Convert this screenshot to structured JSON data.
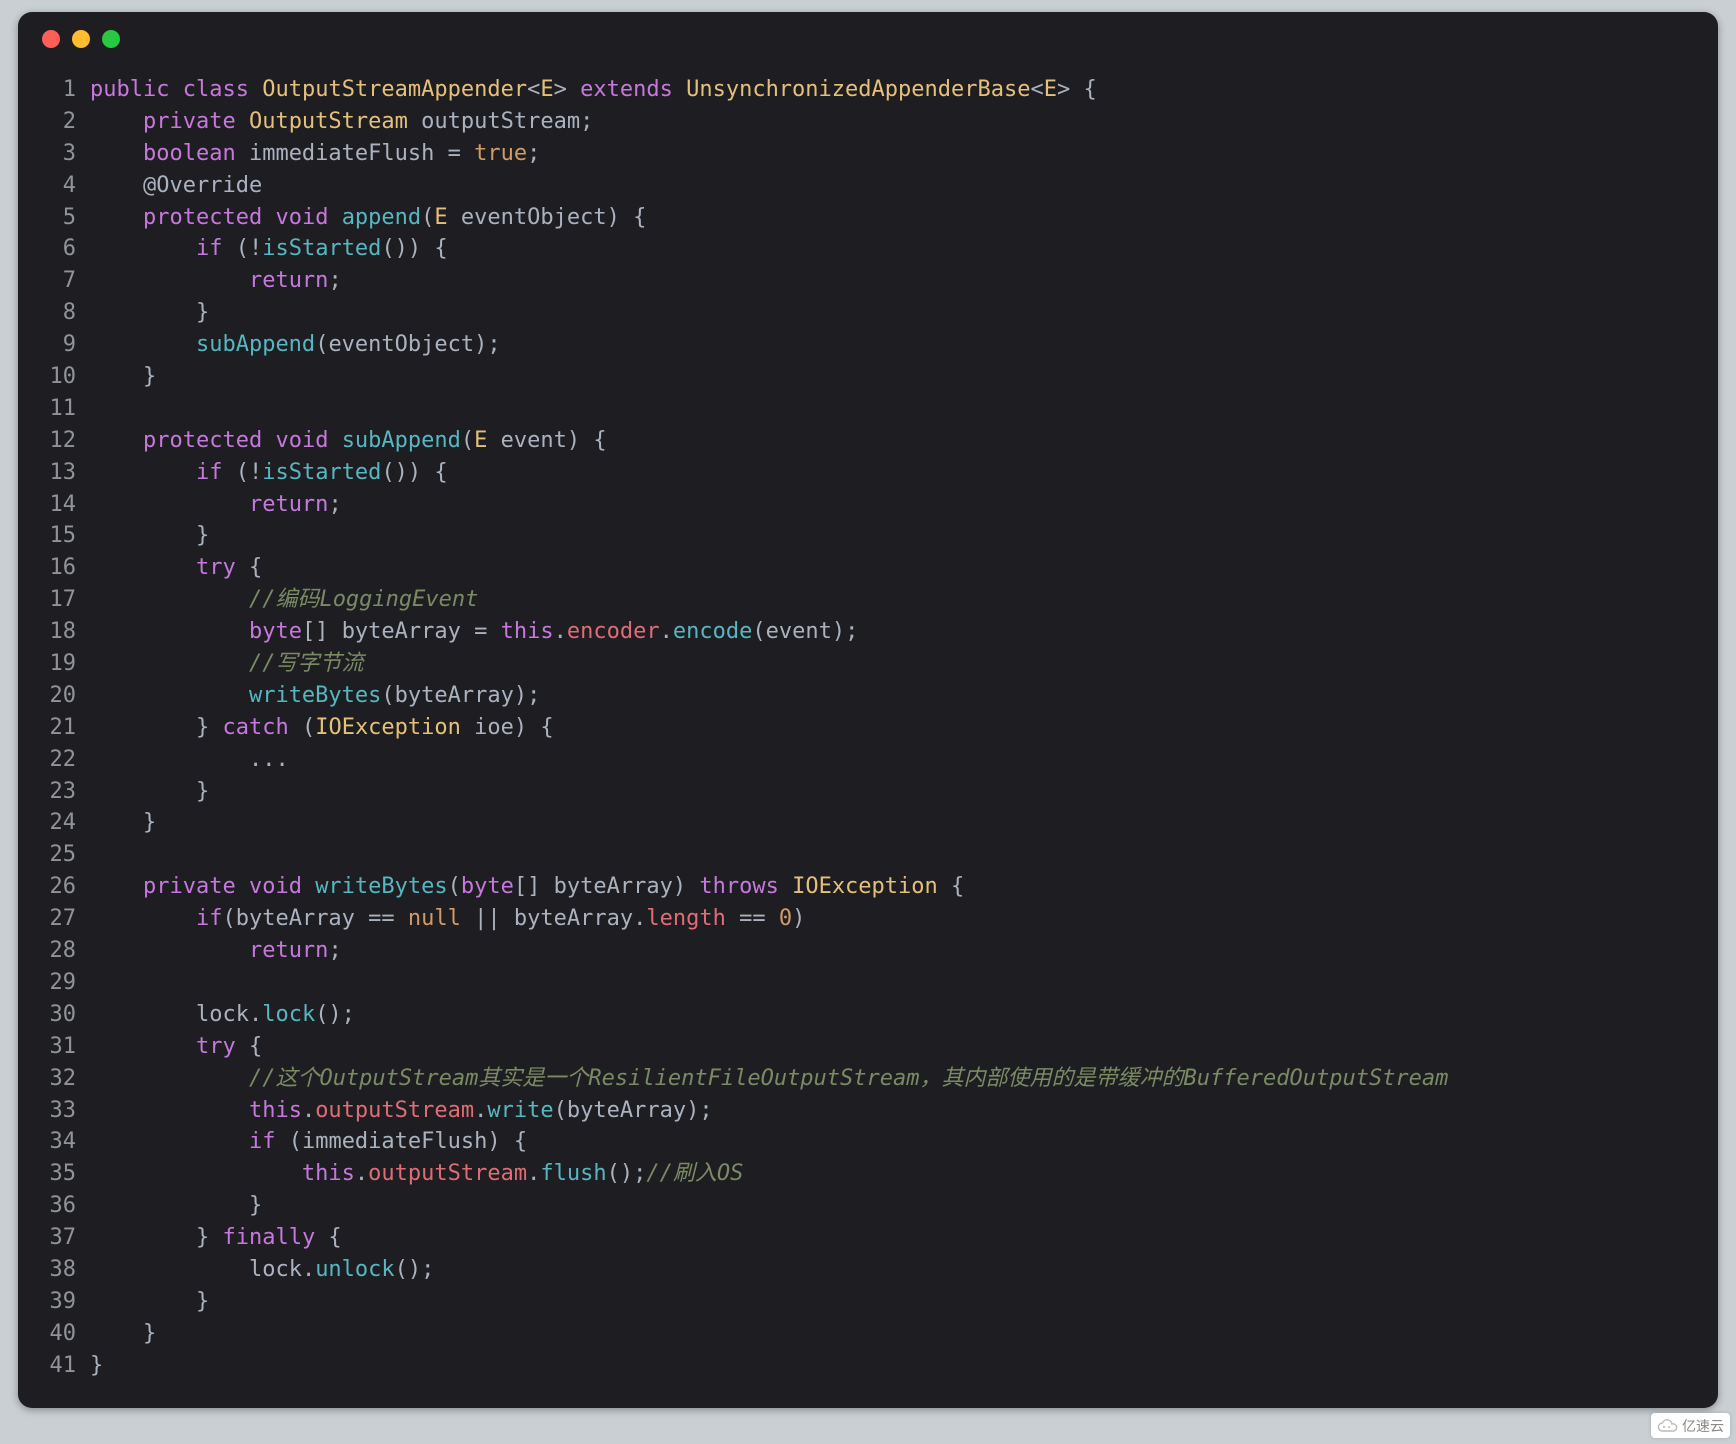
{
  "watermark": "亿速云",
  "lines": [
    {
      "n": 1,
      "tokens": [
        {
          "c": "kw",
          "t": "public"
        },
        {
          "c": "punc",
          "t": " "
        },
        {
          "c": "kw",
          "t": "class"
        },
        {
          "c": "punc",
          "t": " "
        },
        {
          "c": "type",
          "t": "OutputStreamAppender"
        },
        {
          "c": "punc",
          "t": "<"
        },
        {
          "c": "type",
          "t": "E"
        },
        {
          "c": "punc",
          "t": "> "
        },
        {
          "c": "kw",
          "t": "extends"
        },
        {
          "c": "punc",
          "t": " "
        },
        {
          "c": "type",
          "t": "UnsynchronizedAppenderBase"
        },
        {
          "c": "punc",
          "t": "<"
        },
        {
          "c": "type",
          "t": "E"
        },
        {
          "c": "punc",
          "t": "> {"
        }
      ]
    },
    {
      "n": 2,
      "indent": 4,
      "tokens": [
        {
          "c": "kw",
          "t": "private"
        },
        {
          "c": "punc",
          "t": " "
        },
        {
          "c": "type",
          "t": "OutputStream"
        },
        {
          "c": "punc",
          "t": " "
        },
        {
          "c": "var",
          "t": "outputStream"
        },
        {
          "c": "punc",
          "t": ";"
        }
      ]
    },
    {
      "n": 3,
      "indent": 4,
      "tokens": [
        {
          "c": "kw",
          "t": "boolean"
        },
        {
          "c": "punc",
          "t": " "
        },
        {
          "c": "var",
          "t": "immediateFlush"
        },
        {
          "c": "punc",
          "t": " = "
        },
        {
          "c": "lit",
          "t": "true"
        },
        {
          "c": "punc",
          "t": ";"
        }
      ]
    },
    {
      "n": 4,
      "indent": 4,
      "tokens": [
        {
          "c": "ann",
          "t": "@Override"
        }
      ]
    },
    {
      "n": 5,
      "indent": 4,
      "tokens": [
        {
          "c": "kw",
          "t": "protected"
        },
        {
          "c": "punc",
          "t": " "
        },
        {
          "c": "kw",
          "t": "void"
        },
        {
          "c": "punc",
          "t": " "
        },
        {
          "c": "fn",
          "t": "append"
        },
        {
          "c": "punc",
          "t": "("
        },
        {
          "c": "type",
          "t": "E"
        },
        {
          "c": "punc",
          "t": " "
        },
        {
          "c": "var",
          "t": "eventObject"
        },
        {
          "c": "punc",
          "t": ") {"
        }
      ]
    },
    {
      "n": 6,
      "indent": 8,
      "tokens": [
        {
          "c": "kw",
          "t": "if"
        },
        {
          "c": "punc",
          "t": " (!"
        },
        {
          "c": "fn",
          "t": "isStarted"
        },
        {
          "c": "punc",
          "t": "()) {"
        }
      ]
    },
    {
      "n": 7,
      "indent": 12,
      "tokens": [
        {
          "c": "kw",
          "t": "return"
        },
        {
          "c": "punc",
          "t": ";"
        }
      ]
    },
    {
      "n": 8,
      "indent": 8,
      "tokens": [
        {
          "c": "punc",
          "t": "}"
        }
      ]
    },
    {
      "n": 9,
      "indent": 8,
      "tokens": [
        {
          "c": "fn",
          "t": "subAppend"
        },
        {
          "c": "punc",
          "t": "("
        },
        {
          "c": "var",
          "t": "eventObject"
        },
        {
          "c": "punc",
          "t": ");"
        }
      ]
    },
    {
      "n": 10,
      "indent": 4,
      "tokens": [
        {
          "c": "punc",
          "t": "}"
        }
      ]
    },
    {
      "n": 11,
      "tokens": []
    },
    {
      "n": 12,
      "indent": 4,
      "tokens": [
        {
          "c": "kw",
          "t": "protected"
        },
        {
          "c": "punc",
          "t": " "
        },
        {
          "c": "kw",
          "t": "void"
        },
        {
          "c": "punc",
          "t": " "
        },
        {
          "c": "fn",
          "t": "subAppend"
        },
        {
          "c": "punc",
          "t": "("
        },
        {
          "c": "type",
          "t": "E"
        },
        {
          "c": "punc",
          "t": " "
        },
        {
          "c": "var",
          "t": "event"
        },
        {
          "c": "punc",
          "t": ") {"
        }
      ]
    },
    {
      "n": 13,
      "indent": 8,
      "tokens": [
        {
          "c": "kw",
          "t": "if"
        },
        {
          "c": "punc",
          "t": " (!"
        },
        {
          "c": "fn",
          "t": "isStarted"
        },
        {
          "c": "punc",
          "t": "()) {"
        }
      ]
    },
    {
      "n": 14,
      "indent": 12,
      "tokens": [
        {
          "c": "kw",
          "t": "return"
        },
        {
          "c": "punc",
          "t": ";"
        }
      ]
    },
    {
      "n": 15,
      "indent": 8,
      "tokens": [
        {
          "c": "punc",
          "t": "}"
        }
      ]
    },
    {
      "n": 16,
      "indent": 8,
      "tokens": [
        {
          "c": "kw",
          "t": "try"
        },
        {
          "c": "punc",
          "t": " {"
        }
      ]
    },
    {
      "n": 17,
      "indent": 12,
      "tokens": [
        {
          "c": "cmnt",
          "t": "//编码LoggingEvent"
        }
      ]
    },
    {
      "n": 18,
      "indent": 12,
      "tokens": [
        {
          "c": "kw",
          "t": "byte"
        },
        {
          "c": "punc",
          "t": "[] "
        },
        {
          "c": "var",
          "t": "byteArray"
        },
        {
          "c": "punc",
          "t": " = "
        },
        {
          "c": "kw",
          "t": "this"
        },
        {
          "c": "punc",
          "t": "."
        },
        {
          "c": "field",
          "t": "encoder"
        },
        {
          "c": "punc",
          "t": "."
        },
        {
          "c": "fn",
          "t": "encode"
        },
        {
          "c": "punc",
          "t": "("
        },
        {
          "c": "var",
          "t": "event"
        },
        {
          "c": "punc",
          "t": ");"
        }
      ]
    },
    {
      "n": 19,
      "indent": 12,
      "tokens": [
        {
          "c": "cmnt",
          "t": "//写字节流"
        }
      ]
    },
    {
      "n": 20,
      "indent": 12,
      "tokens": [
        {
          "c": "fn",
          "t": "writeBytes"
        },
        {
          "c": "punc",
          "t": "("
        },
        {
          "c": "var",
          "t": "byteArray"
        },
        {
          "c": "punc",
          "t": ");"
        }
      ]
    },
    {
      "n": 21,
      "indent": 8,
      "tokens": [
        {
          "c": "punc",
          "t": "} "
        },
        {
          "c": "kw",
          "t": "catch"
        },
        {
          "c": "punc",
          "t": " ("
        },
        {
          "c": "type",
          "t": "IOException"
        },
        {
          "c": "punc",
          "t": " "
        },
        {
          "c": "var",
          "t": "ioe"
        },
        {
          "c": "punc",
          "t": ") {"
        }
      ]
    },
    {
      "n": 22,
      "indent": 12,
      "tokens": [
        {
          "c": "punc",
          "t": "..."
        }
      ]
    },
    {
      "n": 23,
      "indent": 8,
      "tokens": [
        {
          "c": "punc",
          "t": "}"
        }
      ]
    },
    {
      "n": 24,
      "indent": 4,
      "tokens": [
        {
          "c": "punc",
          "t": "}"
        }
      ]
    },
    {
      "n": 25,
      "tokens": []
    },
    {
      "n": 26,
      "indent": 4,
      "tokens": [
        {
          "c": "kw",
          "t": "private"
        },
        {
          "c": "punc",
          "t": " "
        },
        {
          "c": "kw",
          "t": "void"
        },
        {
          "c": "punc",
          "t": " "
        },
        {
          "c": "fn",
          "t": "writeBytes"
        },
        {
          "c": "punc",
          "t": "("
        },
        {
          "c": "kw",
          "t": "byte"
        },
        {
          "c": "punc",
          "t": "[] "
        },
        {
          "c": "var",
          "t": "byteArray"
        },
        {
          "c": "punc",
          "t": ") "
        },
        {
          "c": "kw",
          "t": "throws"
        },
        {
          "c": "punc",
          "t": " "
        },
        {
          "c": "type",
          "t": "IOException"
        },
        {
          "c": "punc",
          "t": " {"
        }
      ]
    },
    {
      "n": 27,
      "indent": 8,
      "tokens": [
        {
          "c": "kw",
          "t": "if"
        },
        {
          "c": "punc",
          "t": "("
        },
        {
          "c": "var",
          "t": "byteArray"
        },
        {
          "c": "punc",
          "t": " == "
        },
        {
          "c": "lit",
          "t": "null"
        },
        {
          "c": "punc",
          "t": " || "
        },
        {
          "c": "var",
          "t": "byteArray"
        },
        {
          "c": "punc",
          "t": "."
        },
        {
          "c": "field",
          "t": "length"
        },
        {
          "c": "punc",
          "t": " == "
        },
        {
          "c": "lit",
          "t": "0"
        },
        {
          "c": "punc",
          "t": ")"
        }
      ]
    },
    {
      "n": 28,
      "indent": 12,
      "tokens": [
        {
          "c": "kw",
          "t": "return"
        },
        {
          "c": "punc",
          "t": ";"
        }
      ]
    },
    {
      "n": 29,
      "tokens": []
    },
    {
      "n": 30,
      "indent": 8,
      "tokens": [
        {
          "c": "var",
          "t": "lock"
        },
        {
          "c": "punc",
          "t": "."
        },
        {
          "c": "fn",
          "t": "lock"
        },
        {
          "c": "punc",
          "t": "();"
        }
      ]
    },
    {
      "n": 31,
      "indent": 8,
      "tokens": [
        {
          "c": "kw",
          "t": "try"
        },
        {
          "c": "punc",
          "t": " {"
        }
      ]
    },
    {
      "n": 32,
      "indent": 12,
      "tokens": [
        {
          "c": "cmnt",
          "t": "//这个OutputStream其实是一个ResilientFileOutputStream，其内部使用的是带缓冲的BufferedOutputStream"
        }
      ]
    },
    {
      "n": 33,
      "indent": 12,
      "tokens": [
        {
          "c": "kw",
          "t": "this"
        },
        {
          "c": "punc",
          "t": "."
        },
        {
          "c": "field",
          "t": "outputStream"
        },
        {
          "c": "punc",
          "t": "."
        },
        {
          "c": "fn",
          "t": "write"
        },
        {
          "c": "punc",
          "t": "("
        },
        {
          "c": "var",
          "t": "byteArray"
        },
        {
          "c": "punc",
          "t": ");"
        }
      ]
    },
    {
      "n": 34,
      "indent": 12,
      "tokens": [
        {
          "c": "kw",
          "t": "if"
        },
        {
          "c": "punc",
          "t": " ("
        },
        {
          "c": "var",
          "t": "immediateFlush"
        },
        {
          "c": "punc",
          "t": ") {"
        }
      ]
    },
    {
      "n": 35,
      "indent": 16,
      "tokens": [
        {
          "c": "kw",
          "t": "this"
        },
        {
          "c": "punc",
          "t": "."
        },
        {
          "c": "field",
          "t": "outputStream"
        },
        {
          "c": "punc",
          "t": "."
        },
        {
          "c": "fn",
          "t": "flush"
        },
        {
          "c": "punc",
          "t": "();"
        },
        {
          "c": "cmnt",
          "t": "//刷入OS"
        }
      ]
    },
    {
      "n": 36,
      "indent": 12,
      "tokens": [
        {
          "c": "punc",
          "t": "}"
        }
      ]
    },
    {
      "n": 37,
      "indent": 8,
      "tokens": [
        {
          "c": "punc",
          "t": "} "
        },
        {
          "c": "kw",
          "t": "finally"
        },
        {
          "c": "punc",
          "t": " {"
        }
      ]
    },
    {
      "n": 38,
      "indent": 12,
      "tokens": [
        {
          "c": "var",
          "t": "lock"
        },
        {
          "c": "punc",
          "t": "."
        },
        {
          "c": "fn",
          "t": "unlock"
        },
        {
          "c": "punc",
          "t": "();"
        }
      ]
    },
    {
      "n": 39,
      "indent": 8,
      "tokens": [
        {
          "c": "punc",
          "t": "}"
        }
      ]
    },
    {
      "n": 40,
      "indent": 4,
      "tokens": [
        {
          "c": "punc",
          "t": "}"
        }
      ]
    },
    {
      "n": 41,
      "tokens": [
        {
          "c": "punc",
          "t": "}"
        }
      ]
    }
  ]
}
